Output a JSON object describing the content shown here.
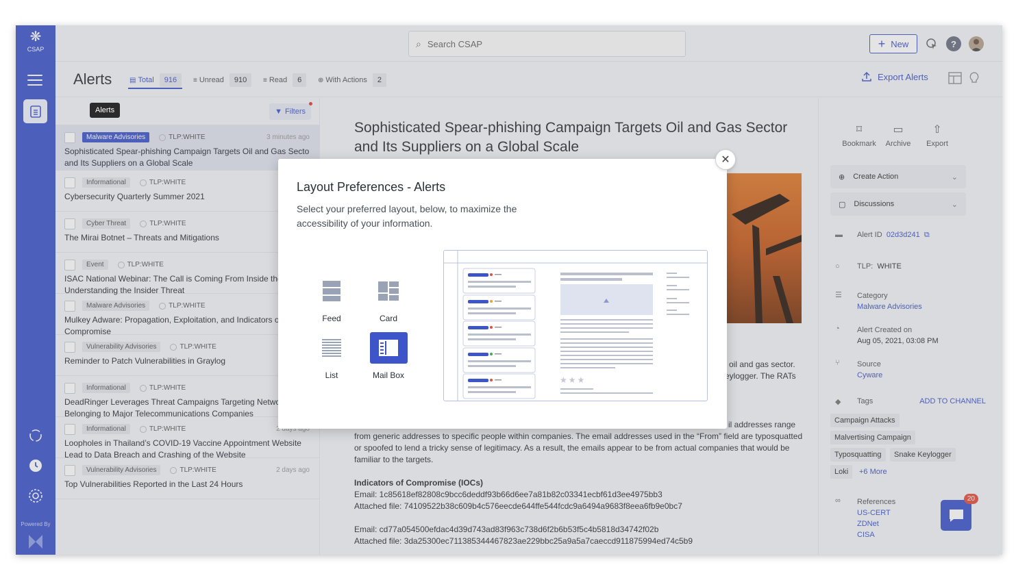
{
  "app": {
    "logo_text": "CSAP",
    "powered_by": "Powered By"
  },
  "search": {
    "placeholder": "Search CSAP"
  },
  "topbar": {
    "new_label": "New",
    "help_label": "?"
  },
  "header": {
    "title": "Alerts",
    "stats": [
      {
        "label": "Total",
        "count": "916"
      },
      {
        "label": "Unread",
        "count": "910"
      },
      {
        "label": "Read",
        "count": "6"
      },
      {
        "label": "With Actions",
        "count": "2"
      }
    ],
    "export_label": "Export Alerts"
  },
  "sidebar": {
    "tooltip": "Alerts"
  },
  "list": {
    "filters_label": "Filters",
    "items": [
      {
        "tag": "Malware Advisories",
        "tlp": "TLP:WHITE",
        "time": "3 minutes ago",
        "title1": "Sophisticated Spear-phishing Campaign Targets Oil and Gas Sector",
        "title2": "and Its Suppliers on a Global Scale"
      },
      {
        "tag": "Informational",
        "tlp": "TLP:WHITE",
        "time": "",
        "title1": "Cybersecurity Quarterly Summer 2021",
        "title2": ""
      },
      {
        "tag": "Cyber Threat",
        "tlp": "TLP:WHITE",
        "time": "",
        "title1": "The Mirai Botnet – Threats and Mitigations",
        "title2": ""
      },
      {
        "tag": "Event",
        "tlp": "TLP:WHITE",
        "time": "",
        "title1": "ISAC National Webinar: The Call is Coming From Inside the H",
        "title2": "Understanding the Insider Threat"
      },
      {
        "tag": "Malware Advisories",
        "tlp": "TLP:WHITE",
        "time": "",
        "title1": "Mulkey Adware: Propagation, Exploitation, and Indicators of",
        "title2": "Compromise"
      },
      {
        "tag": "Vulnerability Advisories",
        "tlp": "TLP:WHITE",
        "time": "",
        "title1": "Reminder to Patch Vulnerabilities in Graylog",
        "title2": ""
      },
      {
        "tag": "Informational",
        "tlp": "TLP:WHITE",
        "time": "",
        "title1": "DeadRinger Leverages Threat Campaigns Targeting Network",
        "title2": "Belonging to Major Telecommunications Companies"
      },
      {
        "tag": "Informational",
        "tlp": "TLP:WHITE",
        "time": "2 days ago",
        "title1": "Loopholes in Thailand’s COVID-19 Vaccine Appointment Website",
        "title2": "Lead to Data Breach and Crashing of the Website"
      },
      {
        "tag": "Vulnerability Advisories",
        "tlp": "TLP:WHITE",
        "time": "2 days ago",
        "title1": "Top Vulnerabilities Reported in the Last 24 Hours",
        "title2": ""
      }
    ]
  },
  "article": {
    "title": "Sophisticated Spear-phishing Campaign Targets Oil and Gas Sector and Its Suppliers on a Global Scale",
    "frag1": "oil and gas sector.",
    "frag2": "eylogger. The RATs",
    "frag3": "il addresses range",
    "para": "from generic addresses to specific people within companies. The email addresses used in the “From” field are typosquatted or spoofed to lend a tricky sense of legitimacy. As a result, the emails appear to be from actual companies that would be familiar to the targets.",
    "ioc_heading": "Indicators of Compromise (IOCs)",
    "ioc1": "Email: 1c85618ef82808c9bcc6deddf93b66d6ee7a81b82c03341ecbf61d3ee4975bb3",
    "ioc2": "Attached file: 74109522b38c609b4c576eecde644ffe544fcdc9a6494a9683f8eea6fb9e0bc7",
    "ioc3": "Email: cd77a054500efdac4d39d743ad83f963c738d6f2b6b53f5c4b5818d34742f02b",
    "ioc4": "Attached file: 3da25300ec711385344467823ae229bbc25a9a5a7caeccd911875994ed74c5b9"
  },
  "details": {
    "bookmark": "Bookmark",
    "archive": "Archive",
    "export": "Export",
    "create_action": "Create Action",
    "discussions": "Discussions",
    "alert_id_label": "Alert ID",
    "alert_id": "02d3d241",
    "tlp_label": "TLP:",
    "tlp_value": "WHITE",
    "category_label": "Category",
    "category_value": "Malware Advisories",
    "created_label": "Alert Created on",
    "created_value": "Aug 05, 2021, 03:08 PM",
    "source_label": "Source",
    "source_value": "Cyware",
    "tags_label": "Tags",
    "add_channel": "ADD TO CHANNEL",
    "tags": [
      "Campaign Attacks",
      "Malvertising Campaign",
      "Typosquatting",
      "Snake Keylogger",
      "Loki"
    ],
    "more": "+6 More",
    "references_label": "References",
    "references": [
      "US-CERT",
      "ZDNet",
      "CISA"
    ],
    "chat_badge": "20"
  },
  "modal": {
    "title": "Layout Preferences - Alerts",
    "subtitle": "Select your preferred layout, below, to maximize the accessibility of your information.",
    "options": [
      {
        "label": "Feed"
      },
      {
        "label": "Card"
      },
      {
        "label": "List"
      },
      {
        "label": "Mail Box",
        "selected": true
      }
    ],
    "close_glyph": "✕",
    "preview_stars": "★★★"
  },
  "colors": {
    "brand": "#3d55c9",
    "badge": "#e34d3c"
  }
}
